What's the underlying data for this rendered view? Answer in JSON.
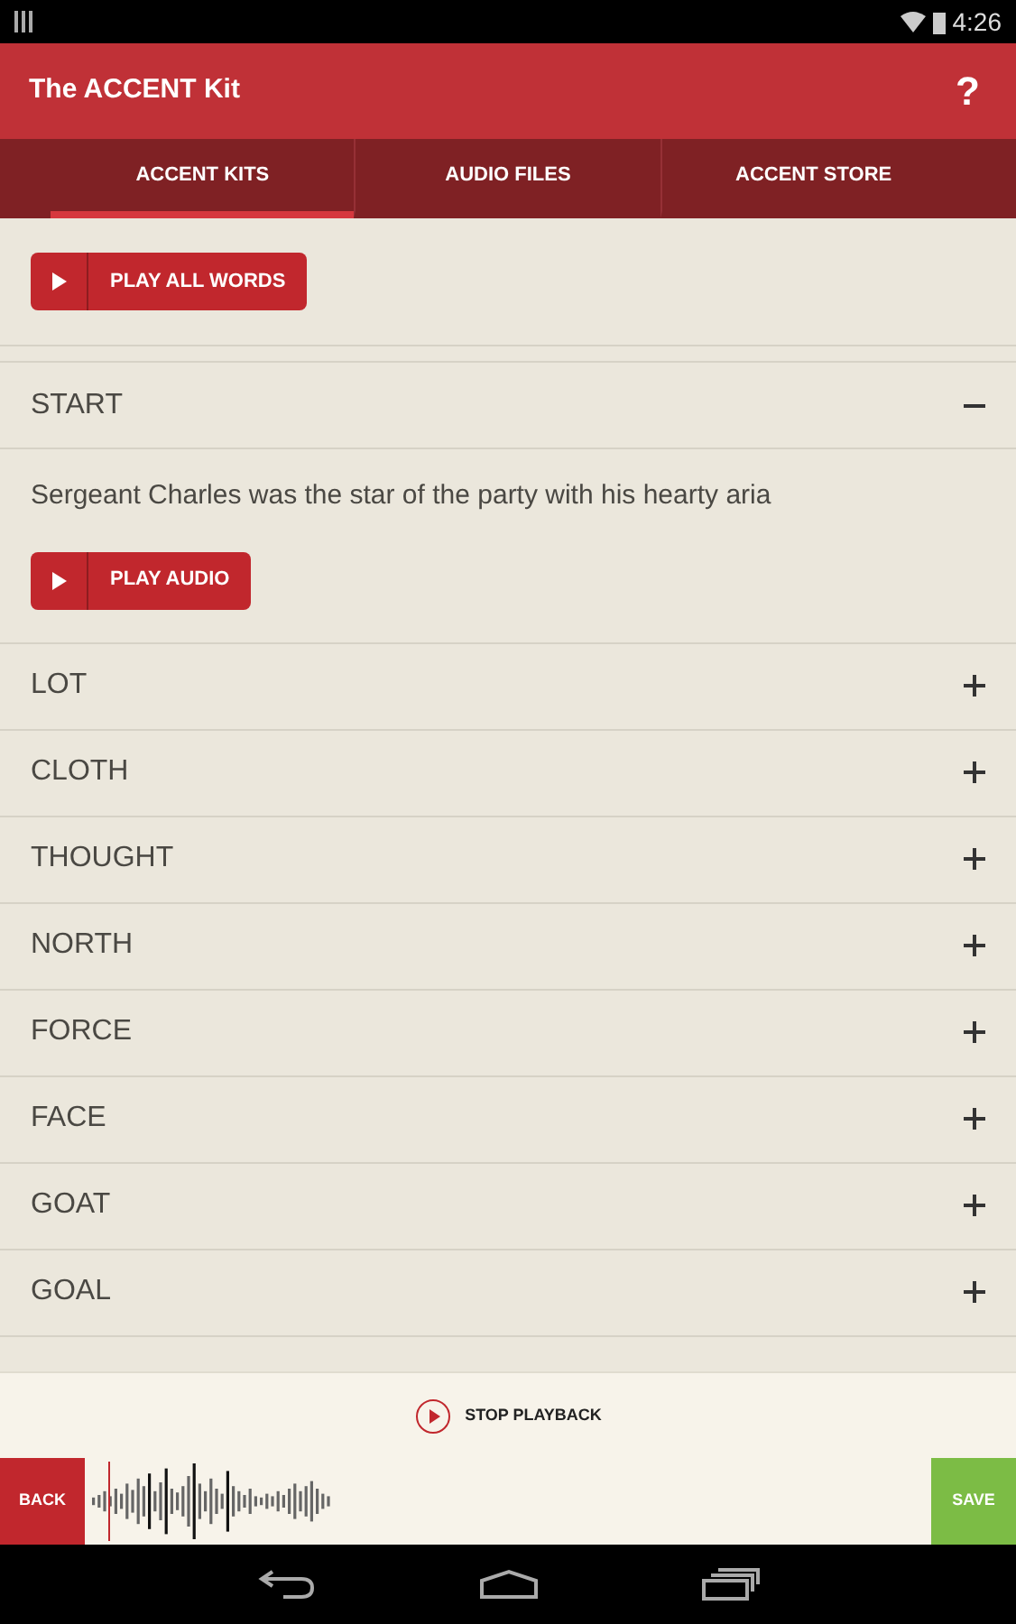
{
  "status_bar": {
    "time": "4:26"
  },
  "app_bar": {
    "title": "The ACCENT Kit",
    "help": "?"
  },
  "tabs": [
    {
      "label": "ACCENT KITS",
      "selected": true
    },
    {
      "label": "AUDIO FILES",
      "selected": false
    },
    {
      "label": "ACCENT STORE",
      "selected": false
    }
  ],
  "play_all_button": "PLAY ALL WORDS",
  "sections": [
    {
      "title": "START",
      "expanded": true,
      "sentence": "Sergeant Charles was the star of the party with his hearty aria",
      "button": "PLAY AUDIO"
    },
    {
      "title": "LOT",
      "expanded": false
    },
    {
      "title": "CLOTH",
      "expanded": false
    },
    {
      "title": "THOUGHT",
      "expanded": false
    },
    {
      "title": "NORTH",
      "expanded": false
    },
    {
      "title": "FORCE",
      "expanded": false
    },
    {
      "title": "FACE",
      "expanded": false
    },
    {
      "title": "GOAT",
      "expanded": false
    },
    {
      "title": "GOAL",
      "expanded": false
    }
  ],
  "playback": {
    "label": "STOP PLAYBACK"
  },
  "recorder": {
    "back": "BACK",
    "save": "SAVE"
  }
}
